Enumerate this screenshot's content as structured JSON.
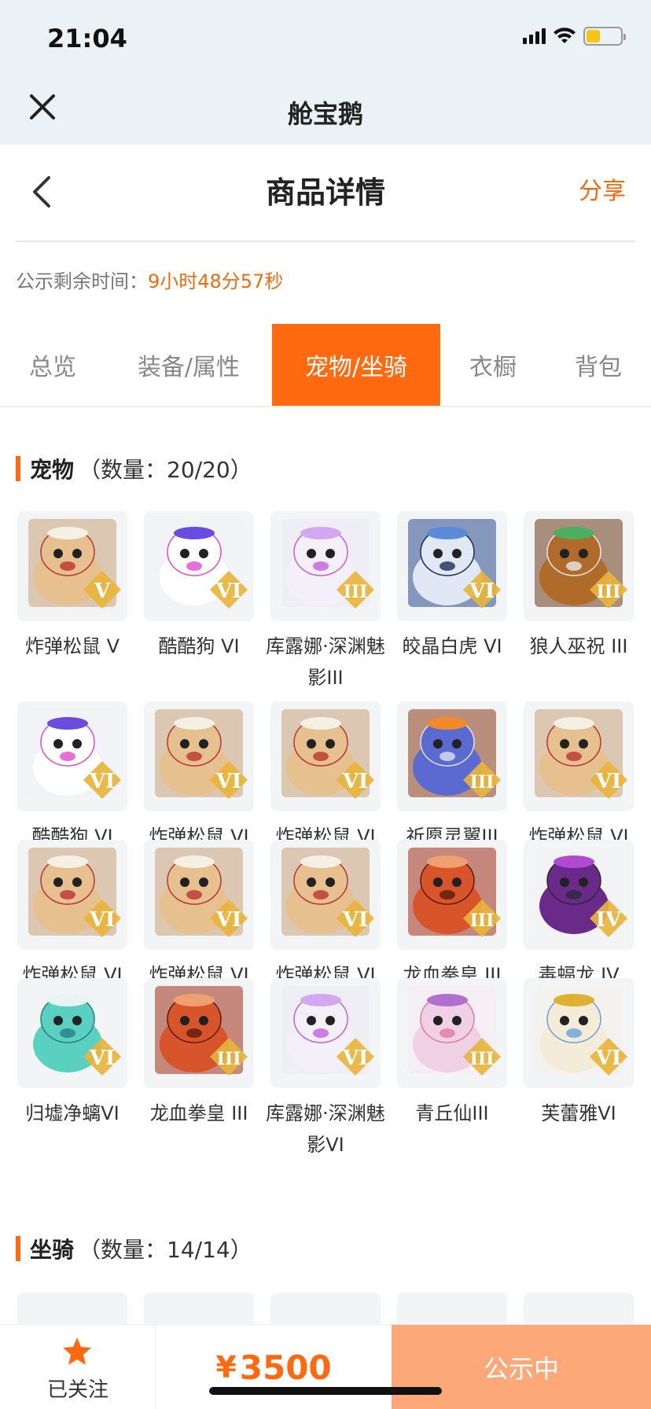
{
  "status_bar": {
    "time": "21:04",
    "battery_color": "#f5c518"
  },
  "app_bar": {
    "title": "舱宝鹅",
    "close_icon": "close-icon"
  },
  "nav": {
    "title": "商品详情",
    "share": "分享",
    "back_icon": "chevron-left-icon"
  },
  "notice": {
    "label": "公示剩余时间：",
    "timer": "9小时48分57秒"
  },
  "tabs": [
    {
      "label": "总览",
      "active": false
    },
    {
      "label": "装备/属性",
      "active": false
    },
    {
      "label": "宠物/坐骑",
      "active": true
    },
    {
      "label": "衣橱",
      "active": false
    },
    {
      "label": "背包",
      "active": false
    }
  ],
  "pets": {
    "title": "宠物",
    "count": "（数量：20/20）",
    "items": [
      {
        "name": "炸弹松鼠 V",
        "grade": "V",
        "art": "squirrel"
      },
      {
        "name": "酷酷狗 VI",
        "grade": "VI",
        "art": "dog"
      },
      {
        "name": "库露娜·深渊魅影III",
        "grade": "III",
        "art": "girl-white"
      },
      {
        "name": "皎晶白虎 VI",
        "grade": "VI",
        "art": "tiger"
      },
      {
        "name": "狼人巫祝 III",
        "grade": "III",
        "art": "wolf"
      },
      {
        "name": "酷酷狗 VI",
        "grade": "VI",
        "art": "dog"
      },
      {
        "name": "炸弹松鼠 VI",
        "grade": "VI",
        "art": "squirrel"
      },
      {
        "name": "炸弹松鼠 VI",
        "grade": "VI",
        "art": "squirrel"
      },
      {
        "name": "祈愿灵翼III",
        "grade": "III",
        "art": "bird"
      },
      {
        "name": "炸弹松鼠 VI",
        "grade": "VI",
        "art": "squirrel"
      },
      {
        "name": "炸弹松鼠 VI",
        "grade": "VI",
        "art": "squirrel"
      },
      {
        "name": "炸弹松鼠 VI",
        "grade": "VI",
        "art": "squirrel"
      },
      {
        "name": "炸弹松鼠 VI",
        "grade": "VI",
        "art": "squirrel"
      },
      {
        "name": "龙血拳皇 III",
        "grade": "III",
        "art": "dragon-red"
      },
      {
        "name": "毒蝠龙 IV",
        "grade": "IV",
        "art": "dragon-purple"
      },
      {
        "name": "归墟净螭VI",
        "grade": "VI",
        "art": "dragon-cyan"
      },
      {
        "name": "龙血拳皇 III",
        "grade": "III",
        "art": "dragon-red"
      },
      {
        "name": "库露娜·深渊魅影VI",
        "grade": "VI",
        "art": "girl-white"
      },
      {
        "name": "青丘仙III",
        "grade": "III",
        "art": "fox-girl"
      },
      {
        "name": "芙蕾雅VI",
        "grade": "VI",
        "art": "goddess"
      }
    ]
  },
  "mounts": {
    "title": "坐骑",
    "count": "（数量：14/14）"
  },
  "bottom": {
    "follow_label": "已关注",
    "follow_icon": "star-icon",
    "price_symbol": "¥",
    "price_value": "3500",
    "status_button": "公示中"
  },
  "colors": {
    "accent": "#ff6a10",
    "status_button": "#fda879",
    "header_bg": "#ebf2f6"
  }
}
